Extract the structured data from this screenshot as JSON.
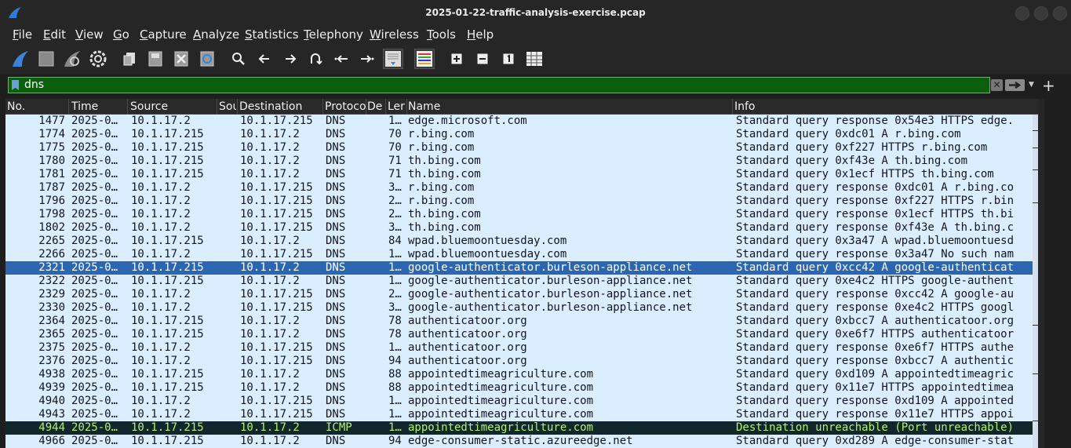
{
  "window": {
    "title": "2025-01-22-traffic-analysis-exercise.pcap"
  },
  "menu": [
    "File",
    "Edit",
    "View",
    "Go",
    "Capture",
    "Analyze",
    "Statistics",
    "Telephony",
    "Wireless",
    "Tools",
    "Help"
  ],
  "toolbar": {
    "icons": [
      "start-capture-icon",
      "stop-capture-icon",
      "restart-capture-icon",
      "capture-options-icon",
      "open-file-icon",
      "save-file-icon",
      "close-file-icon",
      "reload-file-icon",
      "find-packet-icon",
      "go-back-icon",
      "go-forward-icon",
      "go-to-packet-icon",
      "first-packet-icon",
      "last-packet-icon",
      "autoscroll-icon",
      "colorize-icon",
      "zoom-in-icon",
      "zoom-out-icon",
      "normal-size-icon",
      "resize-columns-icon"
    ]
  },
  "filter": {
    "value": "dns"
  },
  "columns": [
    "No.",
    "Time",
    "Source",
    "Sou",
    "Destination",
    "Protoco",
    "De",
    "Ler",
    "Name",
    "Info"
  ],
  "rows": [
    {
      "no": "1477",
      "time": "2025-0…",
      "src": "10.1.17.2",
      "dst": "10.1.17.215",
      "proto": "DNS",
      "len": "1…",
      "name": "edge.microsoft.com",
      "info": "Standard query response 0x54e3 HTTPS edge.",
      "style": "normal"
    },
    {
      "no": "1774",
      "time": "2025-0…",
      "src": "10.1.17.215",
      "dst": "10.1.17.2",
      "proto": "DNS",
      "len": "70",
      "name": "r.bing.com",
      "info": "Standard query 0xdc01 A r.bing.com",
      "style": "normal"
    },
    {
      "no": "1775",
      "time": "2025-0…",
      "src": "10.1.17.215",
      "dst": "10.1.17.2",
      "proto": "DNS",
      "len": "70",
      "name": "r.bing.com",
      "info": "Standard query 0xf227 HTTPS r.bing.com",
      "style": "normal"
    },
    {
      "no": "1780",
      "time": "2025-0…",
      "src": "10.1.17.215",
      "dst": "10.1.17.2",
      "proto": "DNS",
      "len": "71",
      "name": "th.bing.com",
      "info": "Standard query 0xf43e A th.bing.com",
      "style": "normal"
    },
    {
      "no": "1781",
      "time": "2025-0…",
      "src": "10.1.17.215",
      "dst": "10.1.17.2",
      "proto": "DNS",
      "len": "71",
      "name": "th.bing.com",
      "info": "Standard query 0x1ecf HTTPS th.bing.com",
      "style": "normal"
    },
    {
      "no": "1787",
      "time": "2025-0…",
      "src": "10.1.17.2",
      "dst": "10.1.17.215",
      "proto": "DNS",
      "len": "3…",
      "name": "r.bing.com",
      "info": "Standard query response 0xdc01 A r.bing.co",
      "style": "normal"
    },
    {
      "no": "1796",
      "time": "2025-0…",
      "src": "10.1.17.2",
      "dst": "10.1.17.215",
      "proto": "DNS",
      "len": "2…",
      "name": "r.bing.com",
      "info": "Standard query response 0xf227 HTTPS r.bin",
      "style": "normal"
    },
    {
      "no": "1798",
      "time": "2025-0…",
      "src": "10.1.17.2",
      "dst": "10.1.17.215",
      "proto": "DNS",
      "len": "2…",
      "name": "th.bing.com",
      "info": "Standard query response 0x1ecf HTTPS th.bi",
      "style": "normal"
    },
    {
      "no": "1802",
      "time": "2025-0…",
      "src": "10.1.17.2",
      "dst": "10.1.17.215",
      "proto": "DNS",
      "len": "3…",
      "name": "th.bing.com",
      "info": "Standard query response 0xf43e A th.bing.c",
      "style": "normal"
    },
    {
      "no": "2265",
      "time": "2025-0…",
      "src": "10.1.17.215",
      "dst": "10.1.17.2",
      "proto": "DNS",
      "len": "84",
      "name": "wpad.bluemoontuesday.com",
      "info": "Standard query 0x3a47 A wpad.bluemoontuesd",
      "style": "normal"
    },
    {
      "no": "2266",
      "time": "2025-0…",
      "src": "10.1.17.2",
      "dst": "10.1.17.215",
      "proto": "DNS",
      "len": "1…",
      "name": "wpad.bluemoontuesday.com",
      "info": "Standard query response 0x3a47 No such nam",
      "style": "normal"
    },
    {
      "no": "2321",
      "time": "2025-0…",
      "src": "10.1.17.215",
      "dst": "10.1.17.2",
      "proto": "DNS",
      "len": "1…",
      "name": "google-authenticator.burleson-appliance.net",
      "info": "Standard query 0xcc42 A google-authenticat",
      "style": "sel"
    },
    {
      "no": "2322",
      "time": "2025-0…",
      "src": "10.1.17.215",
      "dst": "10.1.17.2",
      "proto": "DNS",
      "len": "1…",
      "name": "google-authenticator.burleson-appliance.net",
      "info": "Standard query 0xe4c2 HTTPS google-authent",
      "style": "normal"
    },
    {
      "no": "2329",
      "time": "2025-0…",
      "src": "10.1.17.2",
      "dst": "10.1.17.215",
      "proto": "DNS",
      "len": "2…",
      "name": "google-authenticator.burleson-appliance.net",
      "info": "Standard query response 0xcc42 A google-au",
      "style": "normal"
    },
    {
      "no": "2330",
      "time": "2025-0…",
      "src": "10.1.17.2",
      "dst": "10.1.17.215",
      "proto": "DNS",
      "len": "3…",
      "name": "google-authenticator.burleson-appliance.net",
      "info": "Standard query response 0xe4c2 HTTPS googl",
      "style": "normal"
    },
    {
      "no": "2364",
      "time": "2025-0…",
      "src": "10.1.17.215",
      "dst": "10.1.17.2",
      "proto": "DNS",
      "len": "78",
      "name": "authenticatoor.org",
      "info": "Standard query 0xbcc7 A authenticatoor.org",
      "style": "normal"
    },
    {
      "no": "2365",
      "time": "2025-0…",
      "src": "10.1.17.215",
      "dst": "10.1.17.2",
      "proto": "DNS",
      "len": "78",
      "name": "authenticatoor.org",
      "info": "Standard query 0xe6f7 HTTPS authenticatoor",
      "style": "normal"
    },
    {
      "no": "2375",
      "time": "2025-0…",
      "src": "10.1.17.2",
      "dst": "10.1.17.215",
      "proto": "DNS",
      "len": "1…",
      "name": "authenticatoor.org",
      "info": "Standard query response 0xe6f7 HTTPS authe",
      "style": "normal"
    },
    {
      "no": "2376",
      "time": "2025-0…",
      "src": "10.1.17.2",
      "dst": "10.1.17.215",
      "proto": "DNS",
      "len": "94",
      "name": "authenticatoor.org",
      "info": "Standard query response 0xbcc7 A authentic",
      "style": "normal"
    },
    {
      "no": "4938",
      "time": "2025-0…",
      "src": "10.1.17.215",
      "dst": "10.1.17.2",
      "proto": "DNS",
      "len": "88",
      "name": "appointedtimeagriculture.com",
      "info": "Standard query 0xd109 A appointedtimeagric",
      "style": "normal"
    },
    {
      "no": "4939",
      "time": "2025-0…",
      "src": "10.1.17.215",
      "dst": "10.1.17.2",
      "proto": "DNS",
      "len": "88",
      "name": "appointedtimeagriculture.com",
      "info": "Standard query 0x11e7 HTTPS appointedtimea",
      "style": "normal"
    },
    {
      "no": "4940",
      "time": "2025-0…",
      "src": "10.1.17.2",
      "dst": "10.1.17.215",
      "proto": "DNS",
      "len": "1…",
      "name": "appointedtimeagriculture.com",
      "info": "Standard query response 0xd109 A appointed",
      "style": "normal"
    },
    {
      "no": "4943",
      "time": "2025-0…",
      "src": "10.1.17.2",
      "dst": "10.1.17.215",
      "proto": "DNS",
      "len": "1…",
      "name": "appointedtimeagriculture.com",
      "info": "Standard query response 0x11e7 HTTPS appoi",
      "style": "normal"
    },
    {
      "no": "4944",
      "time": "2025-0…",
      "src": "10.1.17.215",
      "dst": "10.1.17.2",
      "proto": "ICMP",
      "len": "1…",
      "name": "appointedtimeagriculture.com",
      "info": "Destination unreachable (Port unreachable)",
      "style": "icmp"
    },
    {
      "no": "4966",
      "time": "2025-0…",
      "src": "10.1.17.215",
      "dst": "10.1.17.2",
      "proto": "DNS",
      "len": "94",
      "name": "edge-consumer-static.azureedge.net",
      "info": "Standard query 0xd289 A edge-consumer-stat",
      "style": "normal"
    }
  ],
  "colors": {
    "filter_bg": "#0b5e0b",
    "selected_row": "#2d66b0",
    "row_bg": "#daeeff",
    "icmp_bg": "#12272b",
    "icmp_fg": "#b4f06a"
  }
}
